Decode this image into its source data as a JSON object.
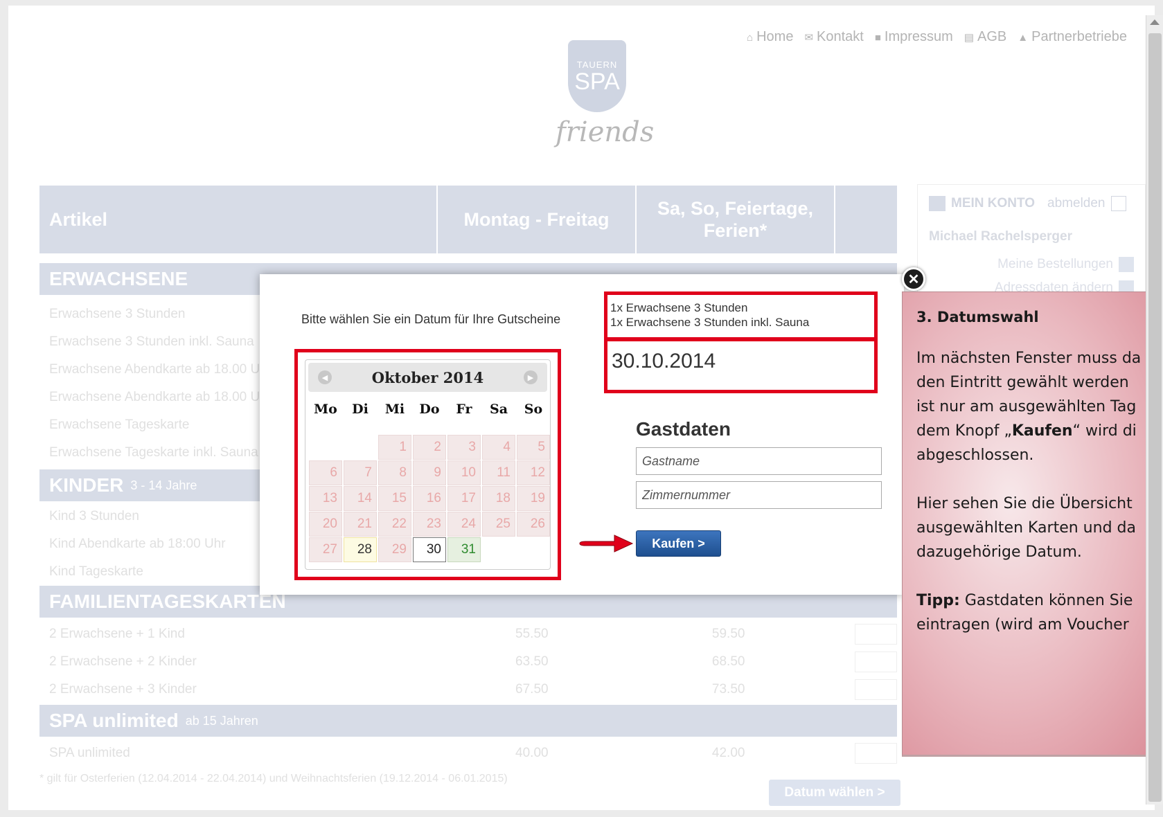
{
  "topnav": {
    "home": "Home",
    "kontakt": "Kontakt",
    "impressum": "Impressum",
    "agb": "AGB",
    "partner": "Partnerbetriebe"
  },
  "logo": {
    "line1": "TAUERN",
    "line2": "SPA",
    "script": "friends"
  },
  "table": {
    "col_artikel": "Artikel",
    "col_weekday": "Montag - Freitag",
    "col_weekend": "Sa, So, Feiertage, Ferien*"
  },
  "sections": {
    "erwachsene": "ERWACHSENE",
    "kinder": "KINDER",
    "kinder_sub": "3 - 14 Jahre",
    "familien": "FAMILIENTAGESKARTEN",
    "spa": "SPA unlimited",
    "spa_sub": "ab 15 Jahren"
  },
  "rows_erwachsene": [
    "Erwachsene 3 Stunden",
    "Erwachsene 3 Stunden inkl. Sauna",
    "Erwachsene Abendkarte ab 18.00 U",
    "Erwachsene Abendkarte ab 18.00 U",
    "Erwachsene Tageskarte",
    "Erwachsene Tageskarte inkl. Sauna"
  ],
  "rows_kinder": [
    "Kind 3 Stunden",
    "Kind Abendkarte ab 18:00 Uhr",
    "Kind Tageskarte"
  ],
  "rows_familien": [
    {
      "name": "2 Erwachsene + 1 Kind",
      "p1": "55.50",
      "p2": "59.50"
    },
    {
      "name": "2 Erwachsene + 2 Kinder",
      "p1": "63.50",
      "p2": "68.50"
    },
    {
      "name": "2 Erwachsene + 3 Kinder",
      "p1": "67.50",
      "p2": "73.50"
    }
  ],
  "rows_spa": [
    {
      "name": "SPA unlimited",
      "p1": "40.00",
      "p2": "42.00"
    }
  ],
  "footnote": "* gilt für Osterferien (12.04.2014 - 22.04.2014) und Weihnachtsferien (19.12.2014 - 06.01.2015)",
  "datum_button": "Datum wählen >",
  "account": {
    "title": "MEIN KONTO",
    "logout": "abmelden",
    "user": "Michael Rachelsperger",
    "orders": "Meine Bestellungen",
    "address": "Adressdaten ändern"
  },
  "modal": {
    "prompt": "Bitte wählen Sie ein Datum für Ihre Gutscheine",
    "month": "Oktober 2014",
    "weekdays": [
      "Mo",
      "Di",
      "Mi",
      "Do",
      "Fr",
      "Sa",
      "So"
    ],
    "leading_blanks": 2,
    "days_in_month": 31,
    "today": 28,
    "selected": 30,
    "available": [
      31
    ],
    "items": [
      "1x Erwachsene 3 Stunden",
      "1x Erwachsene 3 Stunden inkl. Sauna"
    ],
    "date": "30.10.2014",
    "gast_title": "Gastdaten",
    "guest_name_placeholder": "Gastname",
    "room_placeholder": "Zimmernummer",
    "buy": "Kaufen >"
  },
  "note": {
    "title": "3. Datumswahl",
    "p1_line1": "Im nächsten Fenster muss da",
    "p1_line2": "den Eintritt gewählt werden",
    "p1_line3": "ist nur am ausgewählten Tag",
    "p1_line4_pre": "dem Knopf „",
    "p1_line4_bold": "Kaufen",
    "p1_line4_post": "“ wird di",
    "p1_line5": "abgeschlossen.",
    "p2_line1": "Hier sehen Sie die Übersicht",
    "p2_line2": "ausgewählten Karten und da",
    "p2_line3": "dazugehörige Datum.",
    "tipp_label": "Tipp:",
    "tipp_line1": " Gastdaten können Sie",
    "tipp_line2": "eintragen (wird am Voucher"
  },
  "colors": {
    "highlight_red": "#e0001b",
    "table_header": "#d7dce7",
    "buy_button": "#2b5fa6",
    "note_bg": "#e9b7be"
  }
}
